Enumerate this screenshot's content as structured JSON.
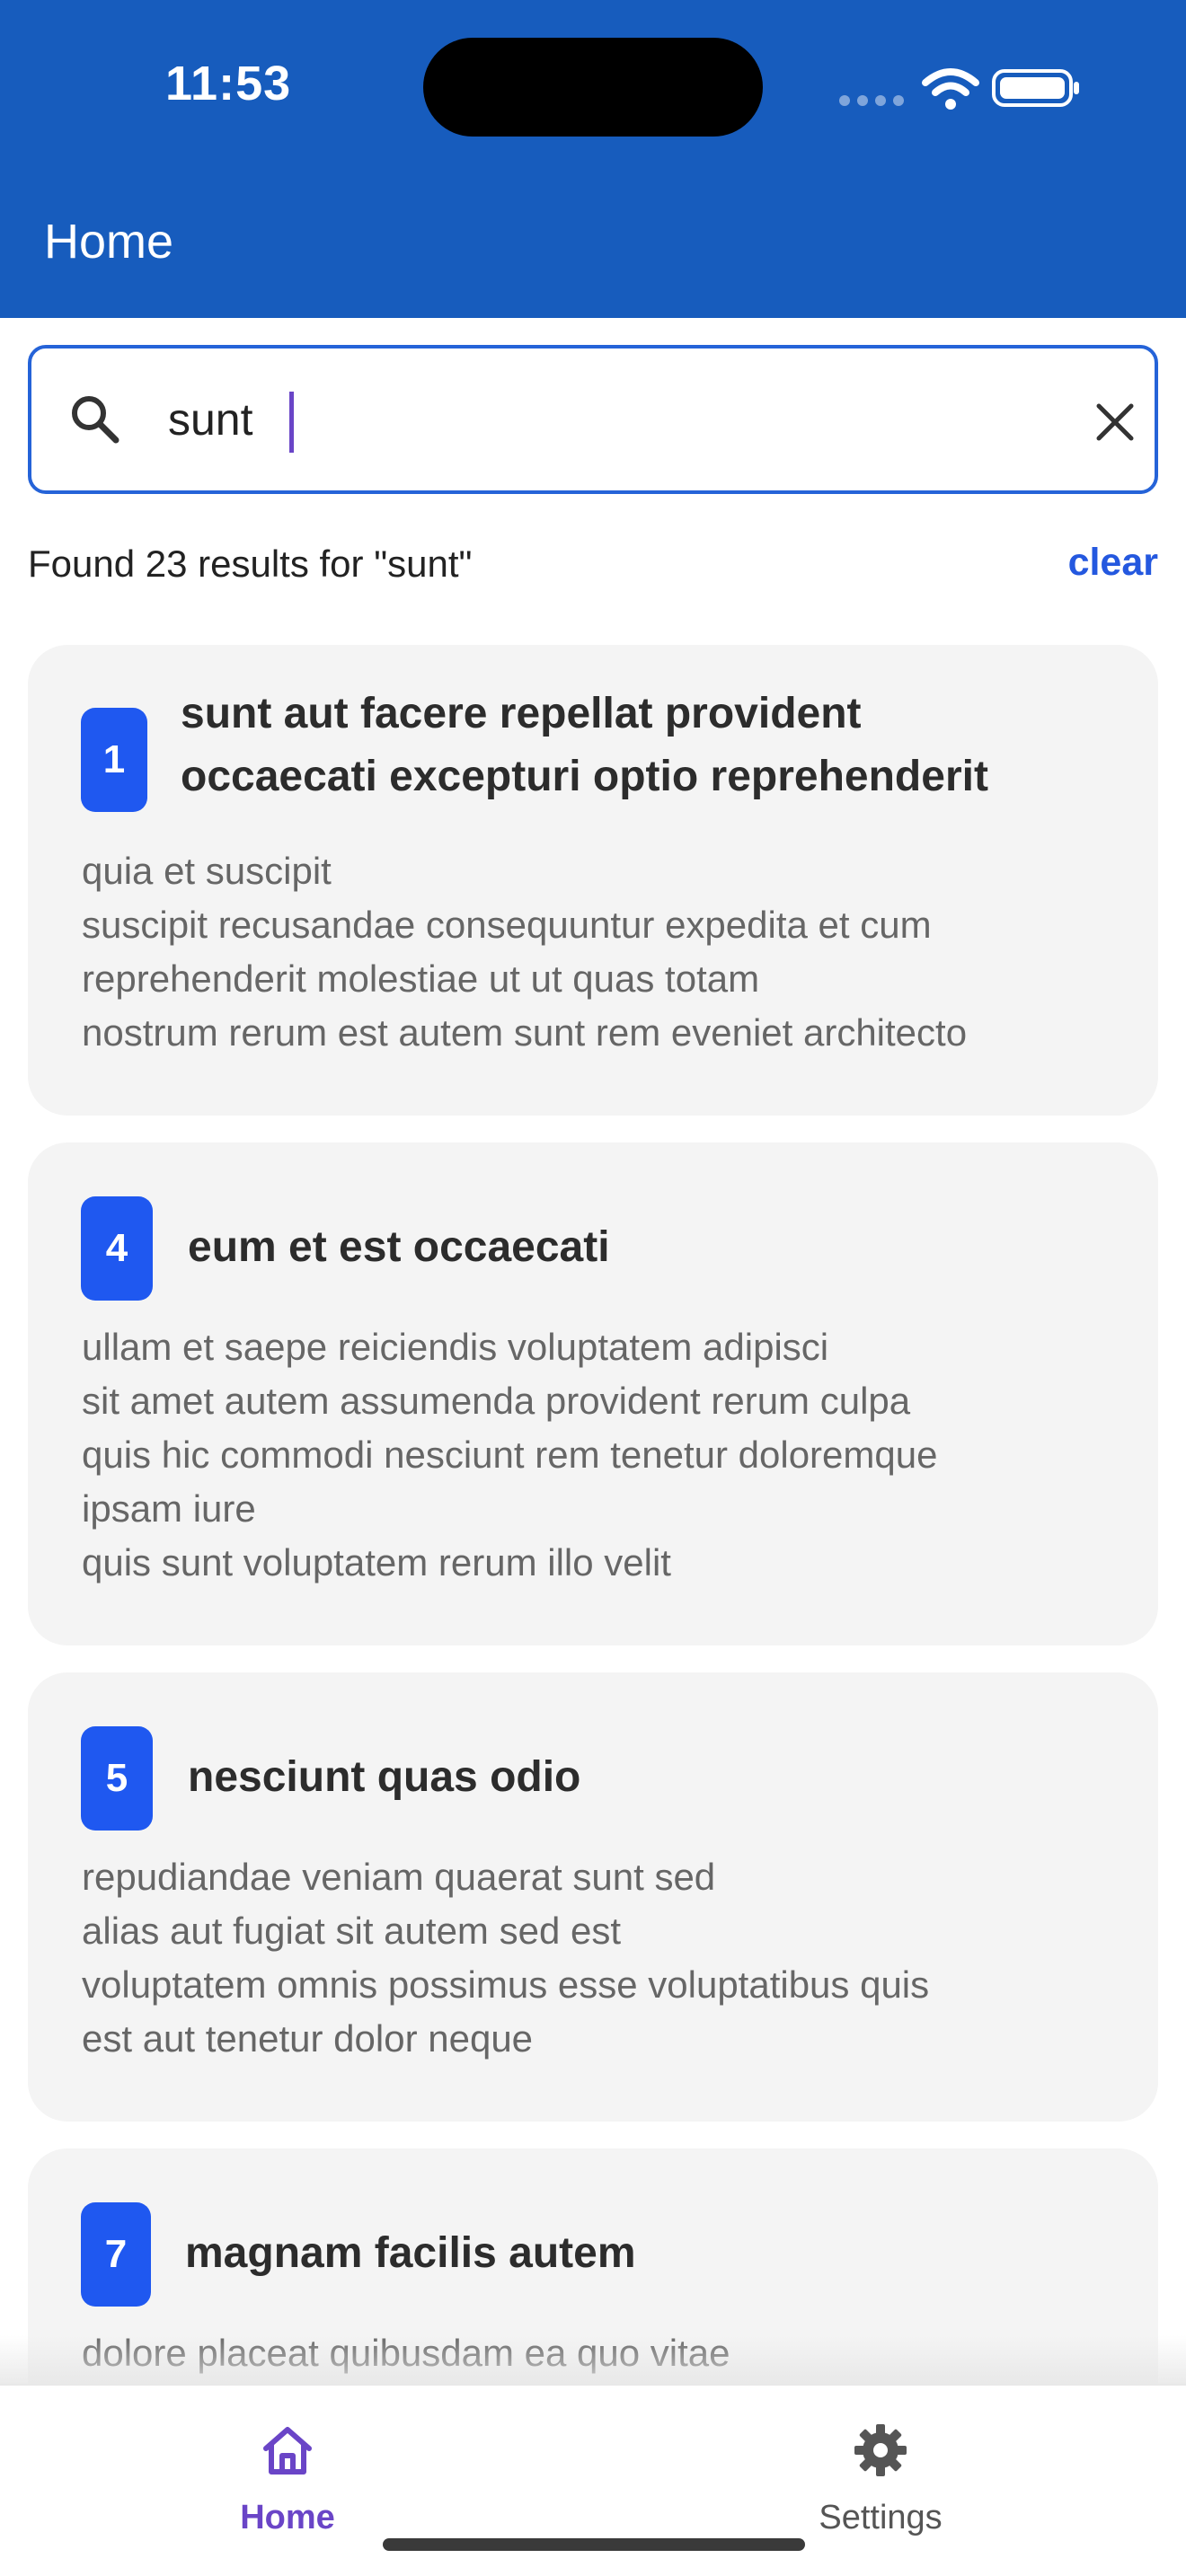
{
  "status_bar": {
    "time": "11:53"
  },
  "header": {
    "title": "Home"
  },
  "search": {
    "value": "sunt",
    "placeholder": ""
  },
  "results": {
    "summary": "Found 23 results for \"sunt\"",
    "clear_label": "clear"
  },
  "cards": [
    {
      "id": "1",
      "title_lines": [
        "sunt aut facere repellat provident",
        "occaecati excepturi optio reprehenderit"
      ],
      "body_lines": [
        "quia et suscipit",
        "suscipit recusandae consequuntur expedita et cum",
        "reprehenderit molestiae ut ut quas totam",
        "nostrum rerum est autem sunt rem eveniet architecto"
      ]
    },
    {
      "id": "4",
      "title_lines": [
        "eum et est occaecati"
      ],
      "body_lines": [
        "ullam et saepe reiciendis voluptatem adipisci",
        "sit amet autem assumenda provident rerum culpa",
        "quis hic commodi nesciunt rem tenetur doloremque",
        "ipsam iure",
        "quis sunt voluptatem rerum illo velit"
      ]
    },
    {
      "id": "5",
      "title_lines": [
        "nesciunt quas odio"
      ],
      "body_lines": [
        "repudiandae veniam quaerat sunt sed",
        "alias aut fugiat sit autem sed est",
        "voluptatem omnis possimus esse voluptatibus quis",
        "est aut tenetur dolor neque"
      ]
    },
    {
      "id": "7",
      "title_lines": [
        "magnam facilis autem"
      ],
      "body_lines": [
        "dolore placeat quibusdam ea quo vitae"
      ]
    }
  ],
  "bottom_nav": {
    "items": [
      {
        "label": "Home",
        "icon": "home-icon",
        "active": true
      },
      {
        "label": "Settings",
        "icon": "gear-icon",
        "active": false
      }
    ]
  },
  "colors": {
    "app_bar": "#175cbd",
    "accent": "#2458df",
    "badge": "#1f58f0",
    "nav_active": "#6a45c7"
  }
}
